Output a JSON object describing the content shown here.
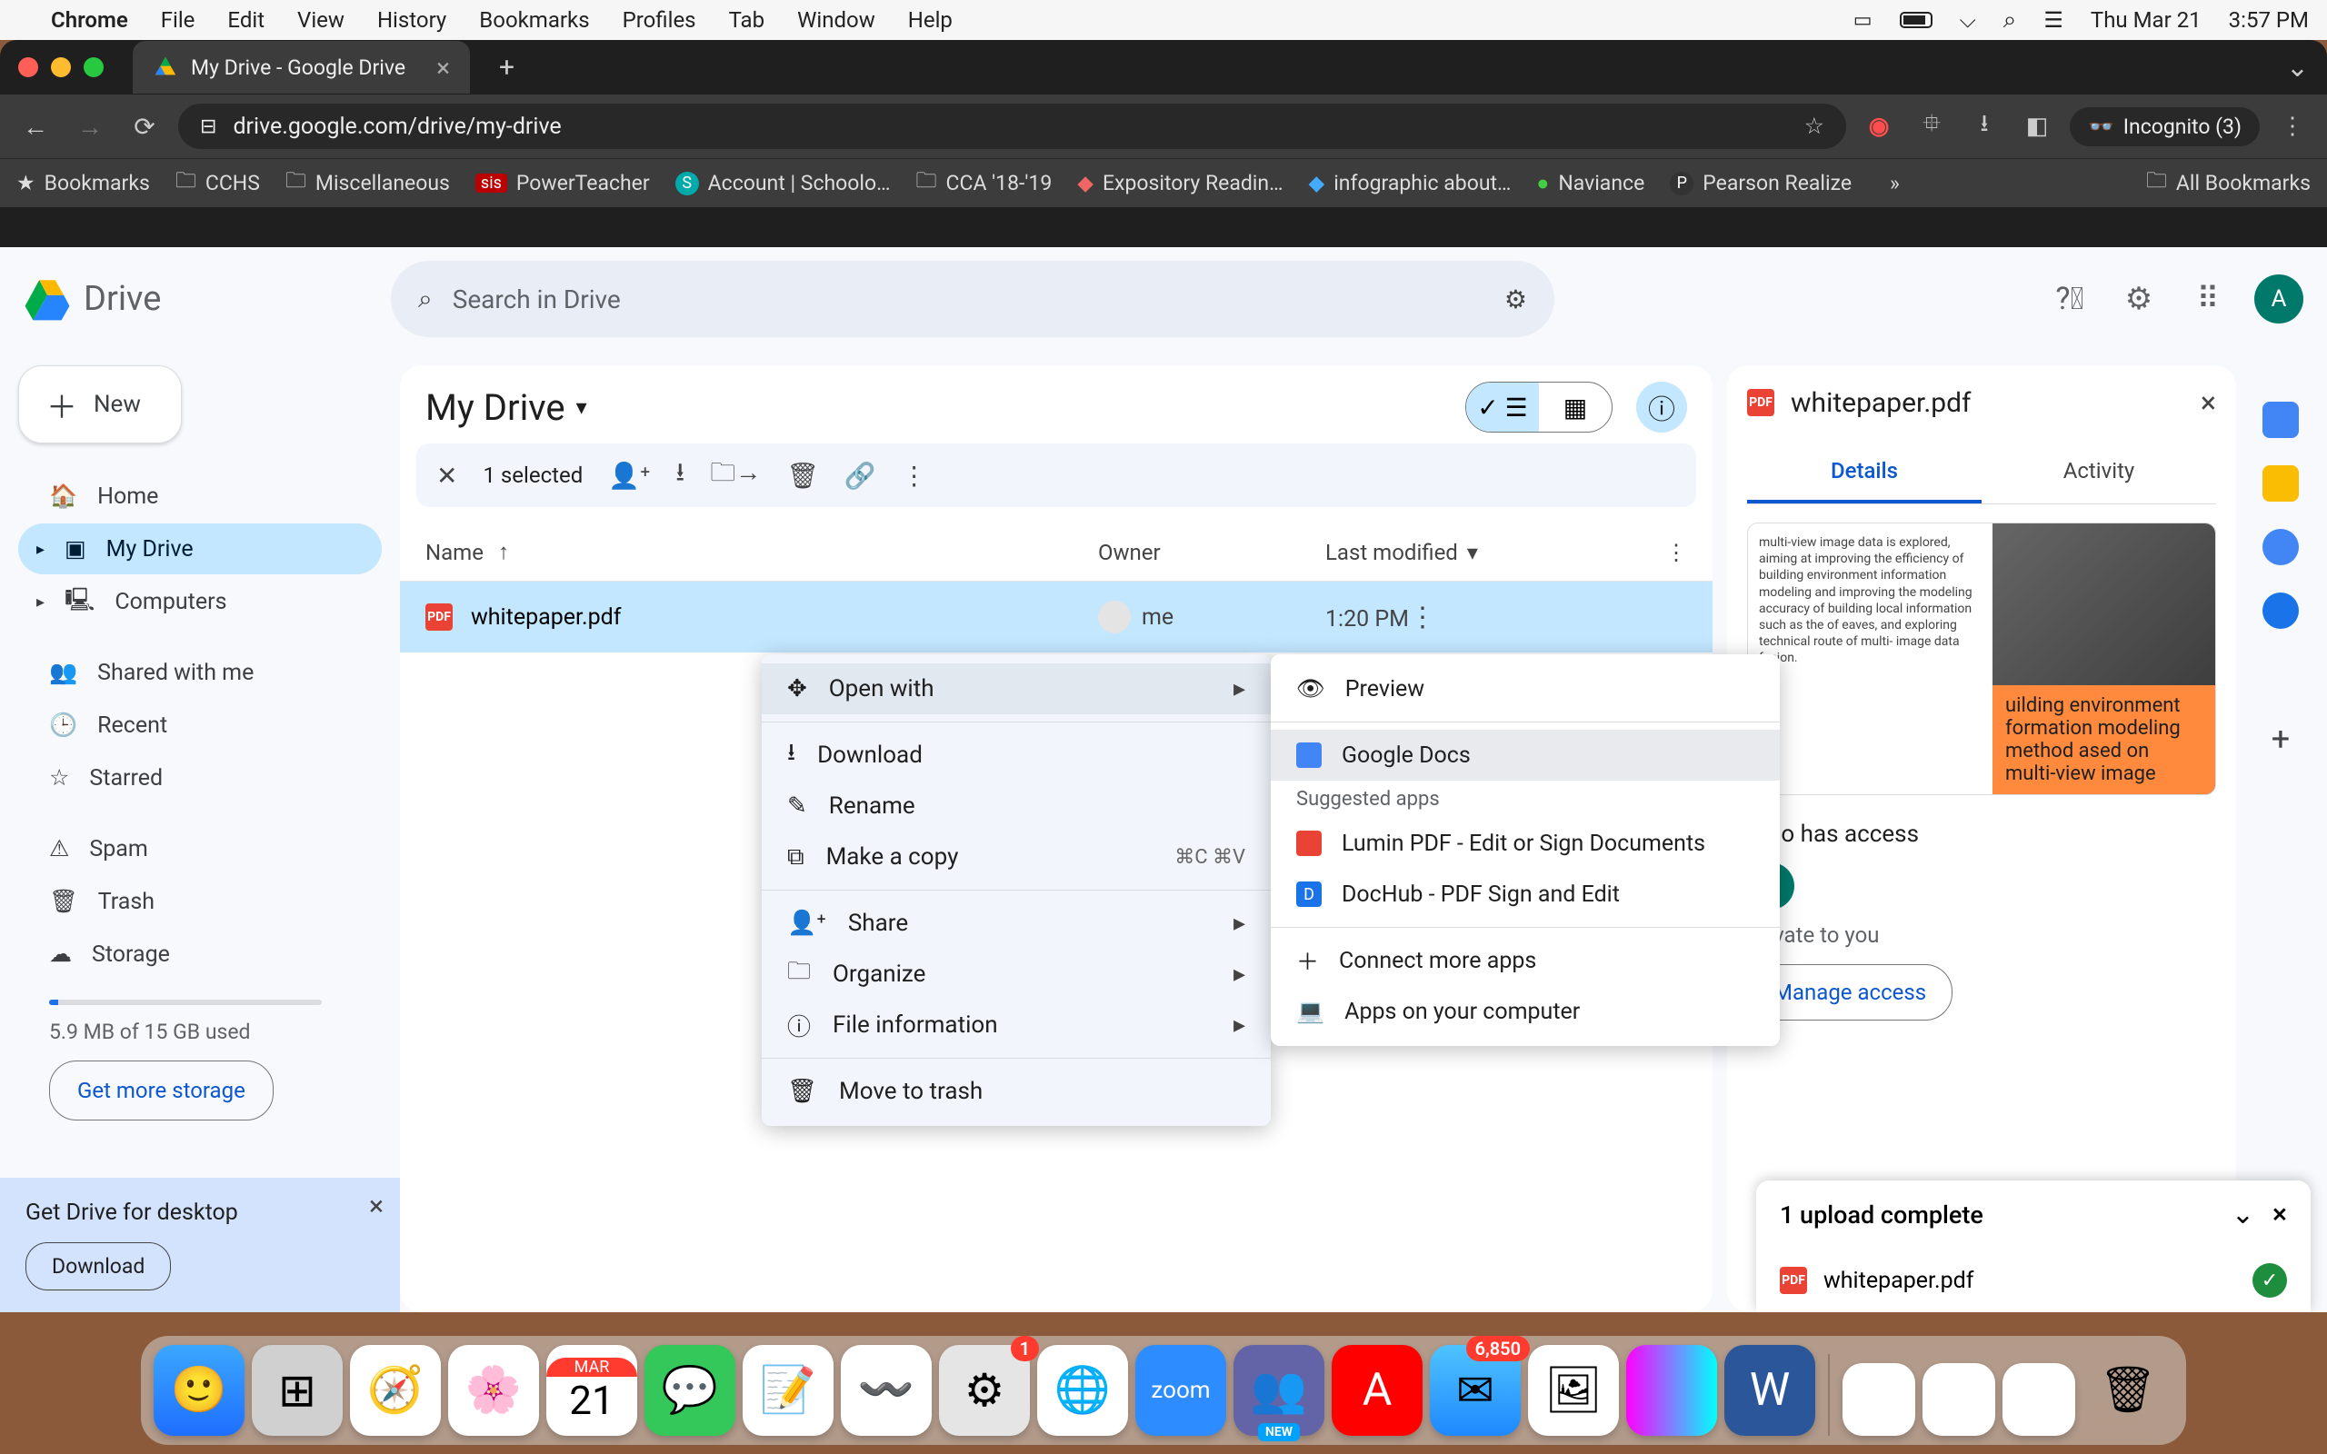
{
  "menubar": {
    "app": "Chrome",
    "items": [
      "File",
      "Edit",
      "View",
      "History",
      "Bookmarks",
      "Profiles",
      "Tab",
      "Window",
      "Help"
    ],
    "date": "Thu Mar 21",
    "time": "3:57 PM"
  },
  "tab": {
    "title": "My Drive - Google Drive"
  },
  "url": "drive.google.com/drive/my-drive",
  "incognito": "Incognito (3)",
  "bookmarks_bar": [
    "Bookmarks",
    "CCHS",
    "Miscellaneous",
    "PowerTeacher",
    "Account | Schoolo…",
    "CCA '18-'19",
    "Expository Readin…",
    "infographic about…",
    "Naviance",
    "Pearson Realize"
  ],
  "all_bookmarks": "All Bookmarks",
  "drive": {
    "brand": "Drive",
    "search_placeholder": "Search in Drive",
    "new_button": "New",
    "nav": {
      "home": "Home",
      "my_drive": "My Drive",
      "computers": "Computers",
      "shared": "Shared with me",
      "recent": "Recent",
      "starred": "Starred",
      "spam": "Spam",
      "trash": "Trash",
      "storage": "Storage"
    },
    "storage_text": "5.9 MB of 15 GB used",
    "get_storage": "Get more storage",
    "desktop_promo": {
      "title": "Get Drive for desktop",
      "download": "Download"
    },
    "avatar_letter": "A"
  },
  "main": {
    "title": "My Drive",
    "selected_text": "1 selected",
    "columns": {
      "name": "Name",
      "owner": "Owner",
      "last_modified": "Last modified"
    },
    "file": {
      "name": "whitepaper.pdf",
      "owner": "me",
      "modified": "1:20 PM"
    }
  },
  "context_menu": {
    "open_with": "Open with",
    "download": "Download",
    "rename": "Rename",
    "make_copy": "Make a copy",
    "make_copy_shortcut": "⌘C ⌘V",
    "share": "Share",
    "organize": "Organize",
    "file_info": "File information",
    "trash": "Move to trash"
  },
  "submenu": {
    "preview": "Preview",
    "google_docs": "Google Docs",
    "suggested": "Suggested apps",
    "lumin": "Lumin PDF - Edit or Sign Documents",
    "dochub": "DocHub - PDF Sign and Edit",
    "connect": "Connect more apps",
    "computer": "Apps on your computer"
  },
  "details": {
    "filename": "whitepaper.pdf",
    "tab_details": "Details",
    "tab_activity": "Activity",
    "preview_text": "multi-view image data is explored, aiming at improving the efficiency of building environment information modeling and improving the modeling accuracy of building local information such as the of eaves, and exploring technical route of multi- image data fusion.",
    "preview_orange": "uilding environment formation modeling method ased on multi-view image",
    "who_access": "Who has access",
    "private": "Private to you",
    "manage": "Manage access"
  },
  "upload": {
    "title": "1 upload complete",
    "file": "whitepaper.pdf"
  },
  "dock_badges": {
    "mail": "6,850",
    "system": "1",
    "cal_month": "MAR",
    "cal_day": "21"
  },
  "colors": {
    "blue": "#0b57d0",
    "sel": "#c2e7ff",
    "google_red": "#ea4335"
  }
}
